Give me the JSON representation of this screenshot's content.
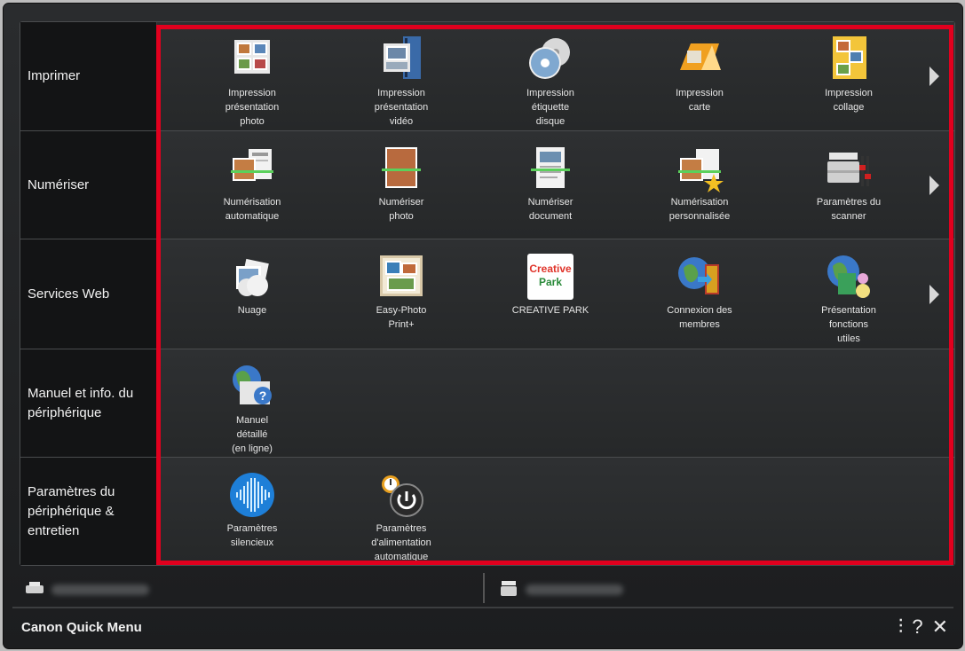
{
  "app": {
    "title": "Canon Quick Menu"
  },
  "colors": {
    "highlight": "#e1001e",
    "background": "#222426"
  },
  "rows": [
    {
      "label": "Imprimer",
      "items": [
        {
          "name": "impression-presentation-photo",
          "icon": "photo-layout-icon",
          "lines": [
            "Impression",
            "présentation",
            "photo"
          ]
        },
        {
          "name": "impression-presentation-video",
          "icon": "video-layout-icon",
          "lines": [
            "Impression",
            "présentation",
            "vidéo"
          ]
        },
        {
          "name": "impression-etiquette-disque",
          "icon": "disc-label-icon",
          "lines": [
            "Impression",
            "étiquette",
            "disque"
          ]
        },
        {
          "name": "impression-carte",
          "icon": "card-icon",
          "lines": [
            "Impression",
            "carte"
          ]
        },
        {
          "name": "impression-collage",
          "icon": "collage-icon",
          "lines": [
            "Impression",
            "collage"
          ]
        }
      ],
      "more": true
    },
    {
      "label": "Numériser",
      "items": [
        {
          "name": "numerisation-automatique",
          "icon": "auto-scan-icon",
          "lines": [
            "Numérisation",
            "automatique"
          ]
        },
        {
          "name": "numeriser-photo",
          "icon": "scan-photo-icon",
          "lines": [
            "Numériser",
            "photo"
          ]
        },
        {
          "name": "numeriser-document",
          "icon": "scan-document-icon",
          "lines": [
            "Numériser",
            "document"
          ]
        },
        {
          "name": "numerisation-personnalisee",
          "icon": "custom-scan-icon",
          "lines": [
            "Numérisation",
            "personnalisée"
          ]
        },
        {
          "name": "parametres-du-scanner",
          "icon": "scanner-settings-icon",
          "lines": [
            "Paramètres du",
            "scanner"
          ]
        }
      ],
      "more": true
    },
    {
      "label": "Services Web",
      "items": [
        {
          "name": "nuage",
          "icon": "cloud-icon",
          "lines": [
            "Nuage"
          ]
        },
        {
          "name": "easy-photo-print",
          "icon": "easy-photo-print-icon",
          "lines": [
            "Easy-Photo",
            "Print+"
          ]
        },
        {
          "name": "creative-park",
          "icon": "creative-park-icon",
          "lines": [
            "CREATIVE PARK"
          ],
          "badge": [
            "Creative",
            "Park"
          ]
        },
        {
          "name": "connexion-des-membres",
          "icon": "member-login-icon",
          "lines": [
            "Connexion des",
            "membres"
          ]
        },
        {
          "name": "presentation-fonctions-utiles",
          "icon": "useful-functions-icon",
          "lines": [
            "Présentation",
            "fonctions",
            "utiles"
          ]
        }
      ],
      "more": true
    },
    {
      "label": "Manuel et info. du périphérique",
      "items": [
        {
          "name": "manuel-detaille",
          "icon": "online-manual-icon",
          "lines": [
            "Manuel",
            "détaillé",
            "(en ligne)"
          ]
        }
      ],
      "more": false
    },
    {
      "label": "Paramètres du périphérique & entretien",
      "items": [
        {
          "name": "parametres-silencieux",
          "icon": "quiet-settings-icon",
          "lines": [
            "Paramètres",
            "silencieux"
          ]
        },
        {
          "name": "parametres-alimentation-automatique",
          "icon": "auto-power-icon",
          "lines": [
            "Paramètres",
            "d'alimentation",
            "automatique"
          ]
        }
      ],
      "more": false
    }
  ],
  "footer": {
    "icons": [
      "preferences-icon",
      "help-icon",
      "close-icon"
    ],
    "glyphs": [
      "⫶",
      "?",
      "✕"
    ]
  }
}
